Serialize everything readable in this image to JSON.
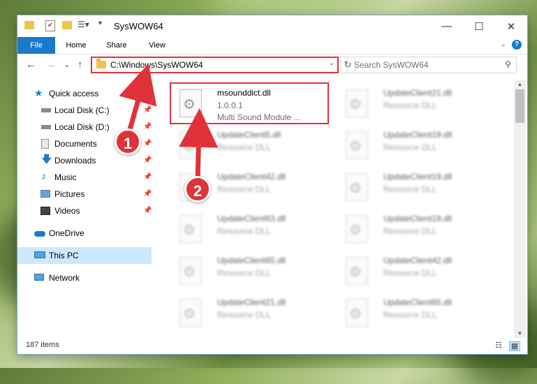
{
  "window": {
    "title": "SysWOW64",
    "minimize_icon": "—",
    "maximize_icon": "☐",
    "close_icon": "✕"
  },
  "ribbon": {
    "tabs": [
      "File",
      "Home",
      "Share",
      "View"
    ],
    "help": "?"
  },
  "nav": {
    "back": "←",
    "forward": "→",
    "recent": "⌄",
    "up": "↑",
    "address": "C:\\Windows\\SysWOW64",
    "refresh": "↻",
    "search_placeholder": "Search SysWOW64"
  },
  "sidebar": {
    "items": [
      {
        "label": "Quick access",
        "icon": "star-icon"
      },
      {
        "label": "Local Disk (C:)",
        "icon": "drive-icon"
      },
      {
        "label": "Local Disk (D:)",
        "icon": "drive-icon"
      },
      {
        "label": "Documents",
        "icon": "documents-icon"
      },
      {
        "label": "Downloads",
        "icon": "downloads-icon"
      },
      {
        "label": "Music",
        "icon": "music-icon"
      },
      {
        "label": "Pictures",
        "icon": "pictures-icon"
      },
      {
        "label": "Videos",
        "icon": "videos-icon"
      },
      {
        "label": "OneDrive",
        "icon": "cloud-icon"
      },
      {
        "label": "This PC",
        "icon": "computer-icon"
      },
      {
        "label": "Network",
        "icon": "network-icon"
      }
    ]
  },
  "files": [
    {
      "name": "msounddict.dll",
      "line2": "1.0.0.1",
      "line3": "Multi Sound Module ..."
    },
    {
      "name": "UpdateClient21.dll",
      "line2": "Resource DLL"
    },
    {
      "name": "UpdateClient5.dll",
      "line2": "Resource DLL"
    },
    {
      "name": "UpdateClient19.dll",
      "line2": "Resource DLL"
    },
    {
      "name": "UpdateClient42.dll",
      "line2": "Resource DLL"
    },
    {
      "name": "UpdateClient19.dll",
      "line2": "Resource DLL"
    },
    {
      "name": "UpdateClient63.dll",
      "line2": "Resource DLL"
    },
    {
      "name": "UpdateClient19.dll",
      "line2": "Resource DLL"
    },
    {
      "name": "UpdateClient65.dll",
      "line2": "Resource DLL"
    },
    {
      "name": "UpdateClient42.dll",
      "line2": "Resource DLL"
    },
    {
      "name": "UpdateClient21.dll",
      "line2": "Resource DLL"
    },
    {
      "name": "UpdateClient65.dll",
      "line2": "Resource DLL"
    }
  ],
  "status": {
    "item_count": "187 items"
  },
  "annotations": {
    "step1": "1",
    "step2": "2",
    "color": "#e0323a"
  }
}
